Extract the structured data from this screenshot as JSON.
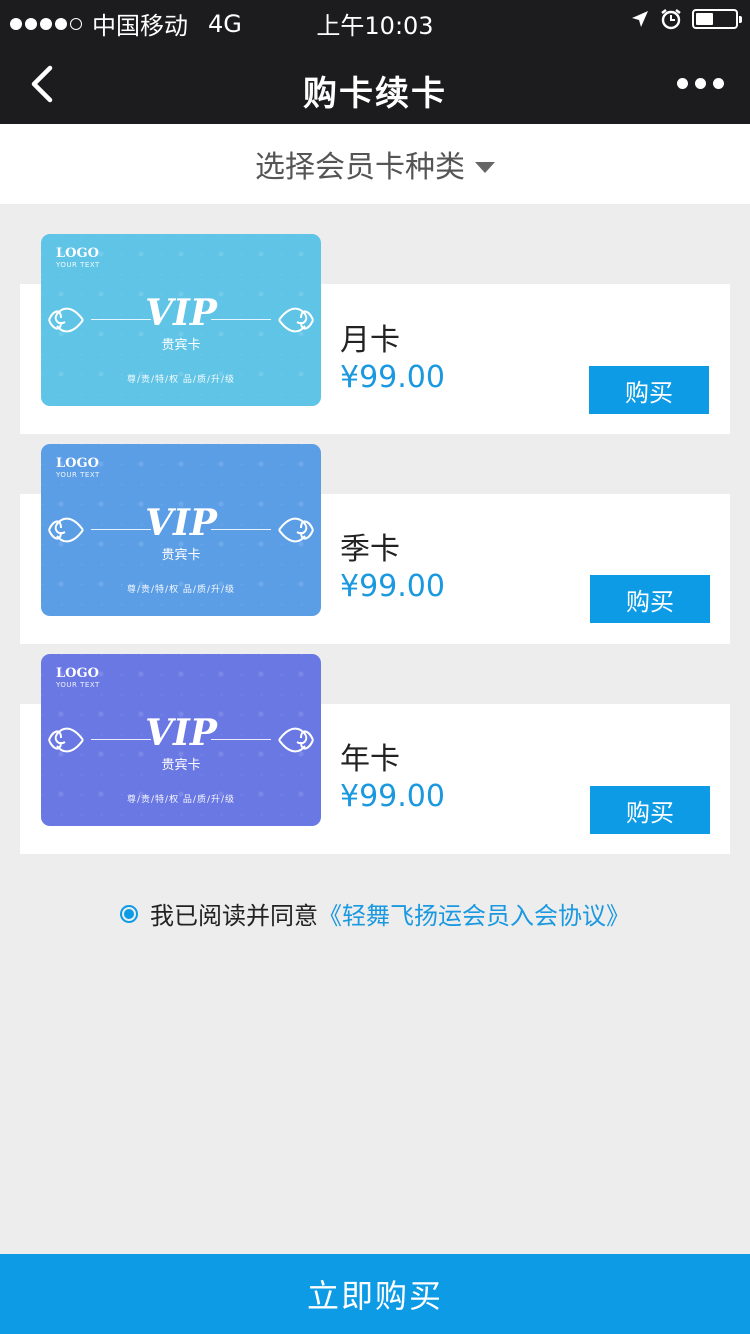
{
  "status_bar": {
    "carrier": "中国移动",
    "network": "4G",
    "time": "上午10:03",
    "signal_filled": 4,
    "signal_total": 5,
    "battery_level": 0.45
  },
  "nav": {
    "title": "购卡续卡",
    "back_icon": "chevron-left-icon",
    "more_icon": "more-dots-icon"
  },
  "selector": {
    "label": "选择会员卡种类",
    "icon": "caret-down-icon"
  },
  "cards": [
    {
      "name": "月卡",
      "price": "¥99.00",
      "buy_label": "购买",
      "card_color": "#5fc4e6",
      "image": {
        "logo": "LOGO",
        "logo_sub": "YOUR TEXT",
        "vip": "VIP",
        "vip_sub": "贵宾卡",
        "tag": "尊/贵/特/权  品/质/升/级"
      }
    },
    {
      "name": "季卡",
      "price": "¥99.00",
      "buy_label": "购买",
      "card_color": "#5b9ee6",
      "image": {
        "logo": "LOGO",
        "logo_sub": "YOUR TEXT",
        "vip": "VIP",
        "vip_sub": "贵宾卡",
        "tag": "尊/贵/特/权  品/质/升/级"
      }
    },
    {
      "name": "年卡",
      "price": "¥99.00",
      "buy_label": "购买",
      "card_color": "#6a78e3",
      "image": {
        "logo": "LOGO",
        "logo_sub": "YOUR TEXT",
        "vip": "VIP",
        "vip_sub": "贵宾卡",
        "tag": "尊/贵/特/权  品/质/升/级"
      }
    }
  ],
  "agreement": {
    "checked": true,
    "text": "我已阅读并同意",
    "link": "《轻舞飞扬运会员入会协议》"
  },
  "footer": {
    "buy_now": "立即购买"
  },
  "colors": {
    "accent": "#0d9be6",
    "price": "#1a98e0",
    "navbar": "#1c1c1e"
  }
}
